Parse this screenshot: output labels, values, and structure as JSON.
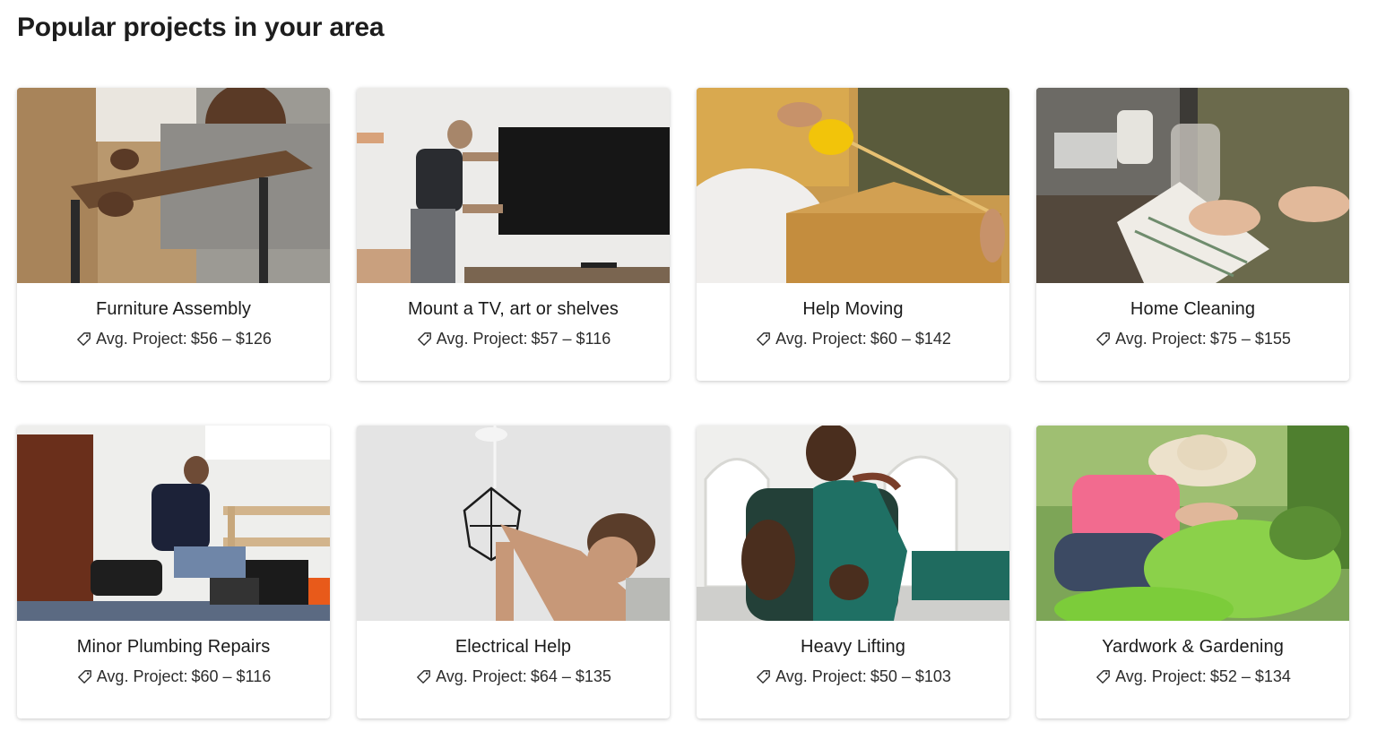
{
  "heading": "Popular projects in your area",
  "cards": [
    {
      "title": "Furniture Assembly",
      "price_prefix": "Avg. Project:",
      "price_range": "$56 – $126",
      "icon": "tag-icon"
    },
    {
      "title": "Mount a TV, art or shelves",
      "price_prefix": "Avg. Project:",
      "price_range": "$57 – $116",
      "icon": "tag-icon"
    },
    {
      "title": "Help Moving",
      "price_prefix": "Avg. Project:",
      "price_range": "$60 – $142",
      "icon": "tag-icon"
    },
    {
      "title": "Home Cleaning",
      "price_prefix": "Avg. Project:",
      "price_range": "$75 – $155",
      "icon": "tag-icon"
    },
    {
      "title": "Minor Plumbing Repairs",
      "price_prefix": "Avg. Project:",
      "price_range": "$60 – $116",
      "icon": "tag-icon"
    },
    {
      "title": "Electrical Help",
      "price_prefix": "Avg. Project:",
      "price_range": "$64 – $135",
      "icon": "tag-icon"
    },
    {
      "title": "Heavy Lifting",
      "price_prefix": "Avg. Project:",
      "price_range": "$50 – $103",
      "icon": "tag-icon"
    },
    {
      "title": "Yardwork & Gardening",
      "price_prefix": "Avg. Project:",
      "price_range": "$52 – $134",
      "icon": "tag-icon"
    }
  ]
}
